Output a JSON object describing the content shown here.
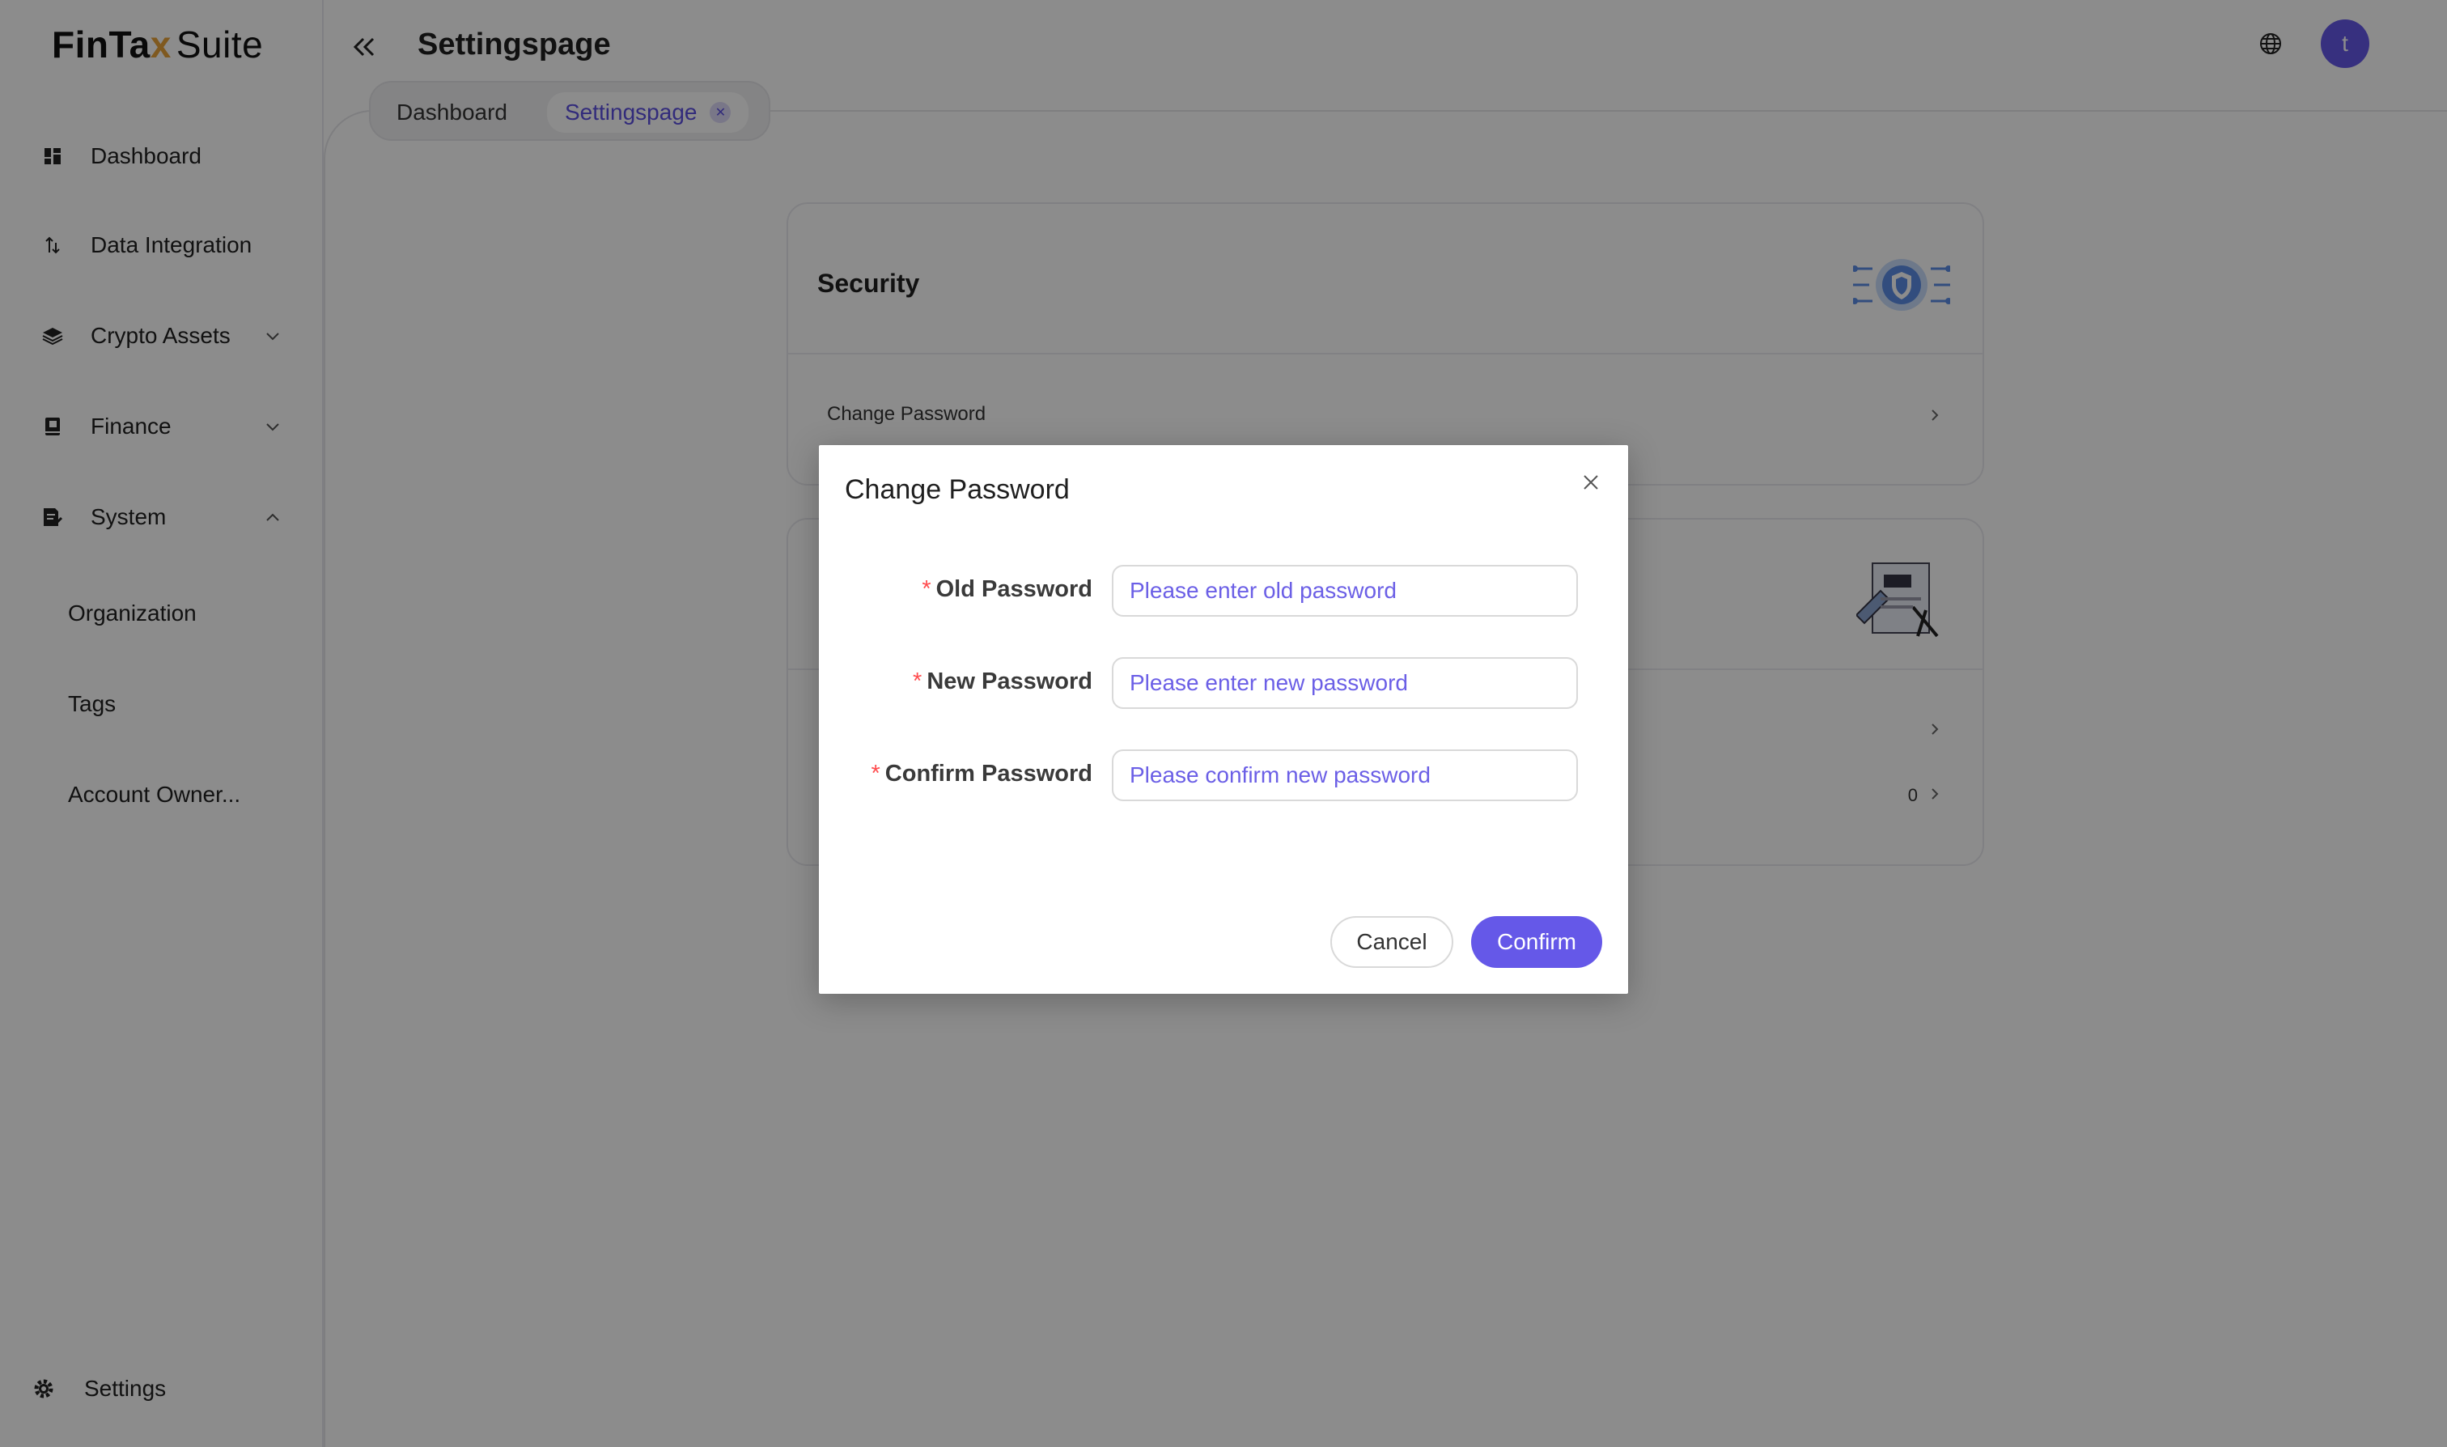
{
  "app": {
    "logo_bold": "FinTa",
    "logo_x": "x",
    "logo_rest": "Suite",
    "page_title": "Settingspage",
    "avatar_initial": "t"
  },
  "sidebar": {
    "items": [
      {
        "label": "Dashboard",
        "icon": "dashboard-icon"
      },
      {
        "label": "Data Integration",
        "icon": "transfer-icon"
      },
      {
        "label": "Crypto Assets",
        "icon": "layers-icon"
      },
      {
        "label": "Finance",
        "icon": "book-icon"
      },
      {
        "label": "System",
        "icon": "file-edit-icon"
      }
    ],
    "sub_items": [
      "Organization",
      "Tags",
      "Account Owner..."
    ],
    "settings_label": "Settings"
  },
  "tabs": [
    {
      "label": "Dashboard"
    },
    {
      "label": "Settingspage",
      "active": true
    }
  ],
  "cards": {
    "security_title": "Security",
    "change_password_row": "Change Password",
    "second_row_count": "0"
  },
  "modal": {
    "title": "Change Password",
    "fields": [
      {
        "label": "Old Password",
        "placeholder": "Please enter old password",
        "required": true
      },
      {
        "label": "New Password",
        "placeholder": "Please enter new password",
        "required": true
      },
      {
        "label": "Confirm Password",
        "placeholder": "Please confirm new password",
        "required": true
      }
    ],
    "required_mark": "*",
    "cancel_label": "Cancel",
    "confirm_label": "Confirm"
  },
  "colors": {
    "accent": "#6558e8",
    "required": "#ff4d4f",
    "overlay": "rgba(0,0,0,0.45)"
  }
}
